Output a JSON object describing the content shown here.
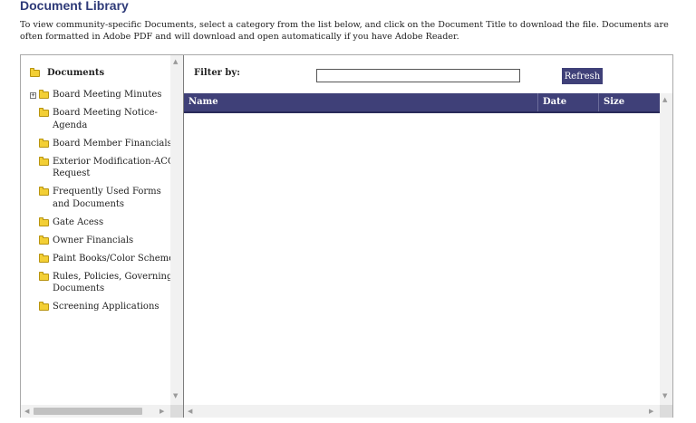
{
  "page": {
    "title": "Document Library",
    "intro": "To view community-specific Documents, select a category from the list below, and click on the Document Title to download the file.  Documents are often formatted in Adobe PDF and will download and open automatically if you have Adobe Reader."
  },
  "tree": {
    "root_label": "Documents",
    "items": [
      {
        "label": "Board Meeting Minutes",
        "expandable": true
      },
      {
        "label": "Board Meeting Notice-Agenda",
        "expandable": false
      },
      {
        "label": "Board Member Financials",
        "expandable": false
      },
      {
        "label": "Exterior Modification-ACC Request",
        "expandable": false
      },
      {
        "label": "Frequently Used Forms and Documents",
        "expandable": false
      },
      {
        "label": "Gate Acess",
        "expandable": false
      },
      {
        "label": "Owner Financials",
        "expandable": false
      },
      {
        "label": "Paint Books/Color Schemes",
        "expandable": false
      },
      {
        "label": "Rules, Policies, Governing Documents",
        "expandable": false
      },
      {
        "label": "Screening Applications",
        "expandable": false
      }
    ]
  },
  "filter": {
    "label": "Filter by:",
    "value": "",
    "placeholder": ""
  },
  "refresh_label": "Refresh",
  "grid": {
    "columns": [
      "Name",
      "Date",
      "Size"
    ],
    "rows": []
  },
  "colors": {
    "title": "#2e3a78",
    "header_bg": "#3f4078",
    "folder": "#f3cf35"
  },
  "icons": {
    "folder": "folder-icon",
    "expand": "expand-plus-icon"
  }
}
